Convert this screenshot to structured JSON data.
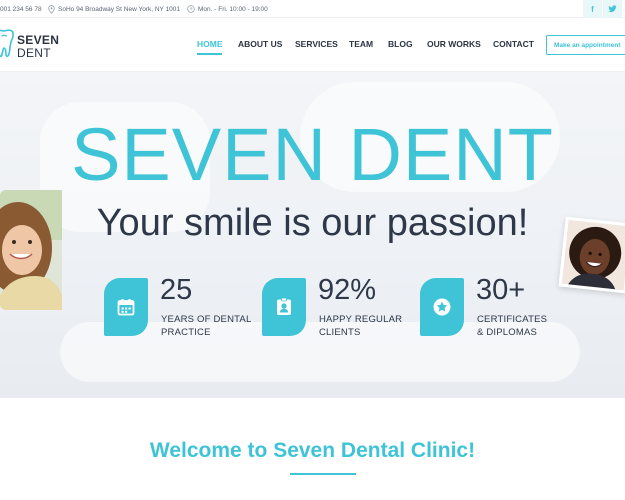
{
  "topbar": {
    "phone": "001 234 56 78",
    "address": "SoHo 94 Broadway St New York, NY 1001",
    "hours": "Mon. - Fri. 10:00 - 19:00",
    "social": [
      {
        "icon": "facebook-icon",
        "glyph": "f"
      },
      {
        "icon": "twitter-icon",
        "glyph": "t"
      }
    ]
  },
  "header": {
    "logo": {
      "line1": "SEVEN",
      "line2": "DENT",
      "icon": "tooth-icon"
    },
    "nav": [
      {
        "label": "HOME",
        "active": true
      },
      {
        "label": "ABOUT US",
        "active": false
      },
      {
        "label": "SERVICES",
        "active": false
      },
      {
        "label": "TEAM",
        "active": false
      },
      {
        "label": "BLOG",
        "active": false
      },
      {
        "label": "OUR WORKS",
        "active": false
      },
      {
        "label": "CONTACT",
        "active": false
      }
    ],
    "appointment_label": "Make an appointment"
  },
  "hero": {
    "title": "SEVEN DENT",
    "subtitle": "Your smile is our passion!",
    "stats": [
      {
        "icon": "calendar-icon",
        "number": "25",
        "caption_line1": "YEARS OF DENTAL",
        "caption_line2": "PRACTICE"
      },
      {
        "icon": "id-badge-icon",
        "number": "92%",
        "caption_line1": "HAPPY REGULAR",
        "caption_line2": "CLIENTS"
      },
      {
        "icon": "star-icon",
        "number": "30+",
        "caption_line1": "CERTIFICATES",
        "caption_line2": "& DIPLOMAS"
      }
    ]
  },
  "welcome": {
    "title": "Welcome to Seven Dental Clinic!"
  },
  "colors": {
    "accent": "#3ec4d6",
    "text": "#2e3848"
  }
}
